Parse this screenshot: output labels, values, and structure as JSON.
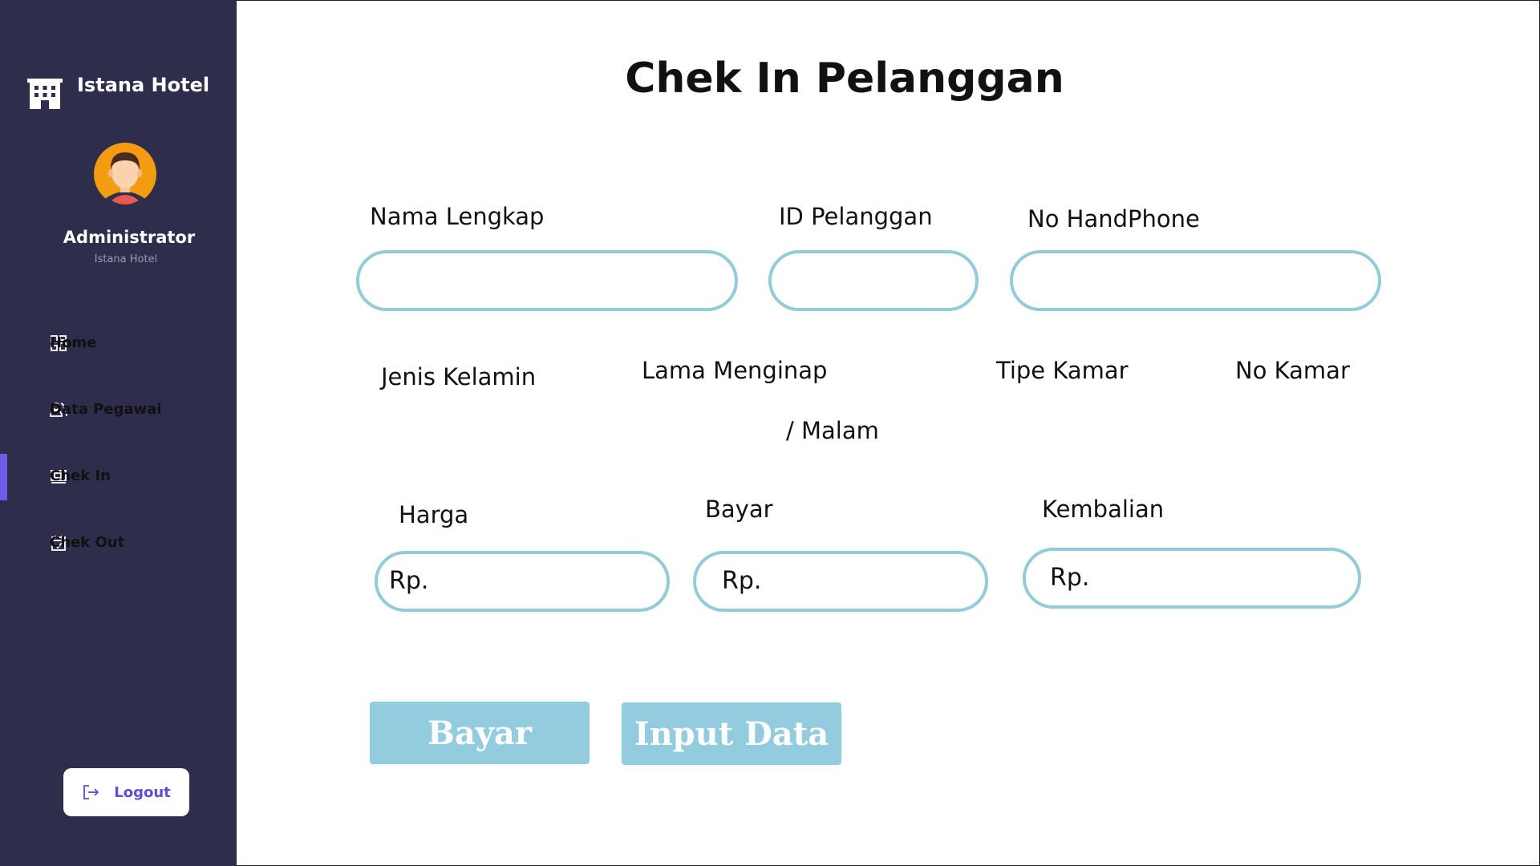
{
  "sidebar": {
    "brand": {
      "name": "Istana Hotel",
      "icon": "hotel-building-icon"
    },
    "profile": {
      "name": "Administrator",
      "subtitle": "Istana Hotel",
      "avatar": "user-avatar"
    },
    "nav": [
      {
        "label": "Home",
        "icon": "dashboard-grid-icon",
        "active": false
      },
      {
        "label": "Data Pegawai",
        "icon": "users-icon",
        "active": false
      },
      {
        "label": "Chek In",
        "icon": "check-in-icon",
        "active": true
      },
      {
        "label": "Chek Out",
        "icon": "calendar-check-icon",
        "active": false
      }
    ],
    "logout": {
      "label": "Logout",
      "icon": "logout-icon"
    },
    "colors": {
      "background": "#2e2d4c",
      "active_indicator": "#6c5ce7",
      "logout_text": "#5b4fd6"
    }
  },
  "main": {
    "title": "Chek In Pelanggan",
    "fields": {
      "nama_lengkap": {
        "label": "Nama Lengkap",
        "value": ""
      },
      "id_pelanggan": {
        "label": "ID Pelanggan",
        "value": ""
      },
      "no_handphone": {
        "label": "No HandPhone",
        "value": ""
      },
      "jenis_kelamin": {
        "label": "Jenis Kelamin"
      },
      "lama_menginap": {
        "label": "Lama Menginap",
        "suffix": "/ Malam"
      },
      "tipe_kamar": {
        "label": "Tipe Kamar"
      },
      "no_kamar": {
        "label": "No Kamar"
      },
      "harga": {
        "label": "Harga",
        "prefix": "Rp."
      },
      "bayar": {
        "label": "Bayar",
        "prefix": "Rp."
      },
      "kembalian": {
        "label": "Kembalian",
        "prefix": "Rp."
      }
    },
    "buttons": {
      "bayar": "Bayar",
      "input_data": "Input Data"
    },
    "colors": {
      "input_border": "#93cbd9",
      "button_bg": "#93cbdf"
    }
  }
}
